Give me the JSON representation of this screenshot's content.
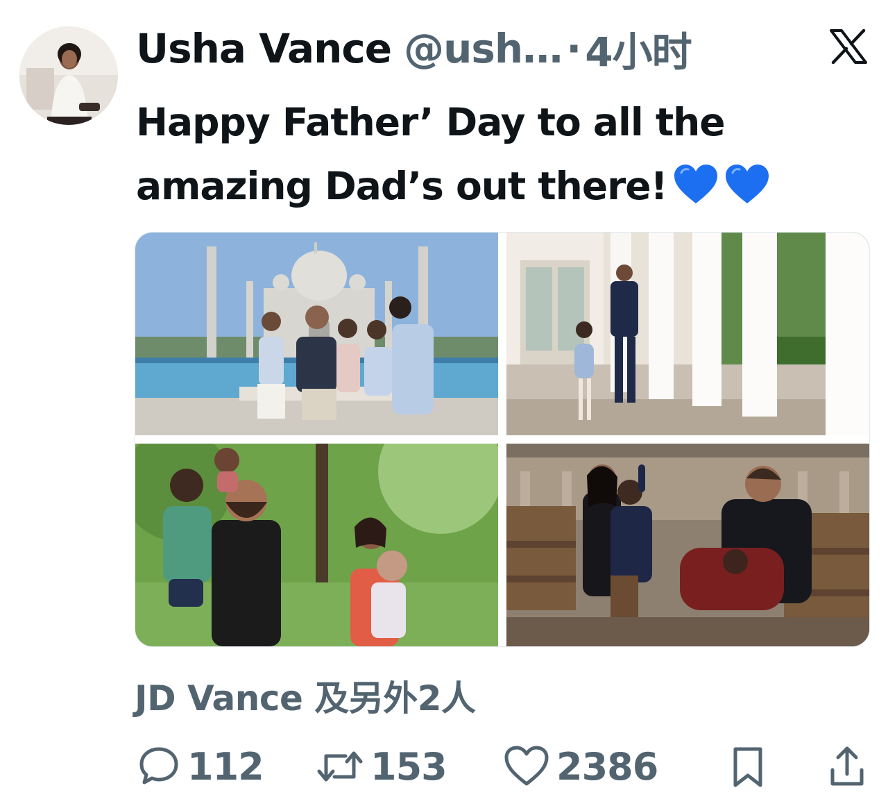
{
  "tweet": {
    "author_name": "Usha Vance",
    "author_handle": "@ush…",
    "separator": "·",
    "timestamp": "4小时",
    "text": "Happy Father’ Day to all the amazing Dad’s out there!",
    "emoji": [
      "blue-heart",
      "blue-heart"
    ],
    "photos": [
      {
        "icon": "photo-taj-mahal-family"
      },
      {
        "icon": "photo-colonnade-walk"
      },
      {
        "icon": "photo-park-family"
      },
      {
        "icon": "photo-church-family"
      }
    ],
    "liked_by": "JD Vance 及另外2人",
    "stats": {
      "replies": "112",
      "reposts": "153",
      "likes": "2386"
    }
  },
  "colors": {
    "text_primary": "#0f1419",
    "text_secondary": "#536471",
    "heart_blue": "#1d6ff2"
  }
}
